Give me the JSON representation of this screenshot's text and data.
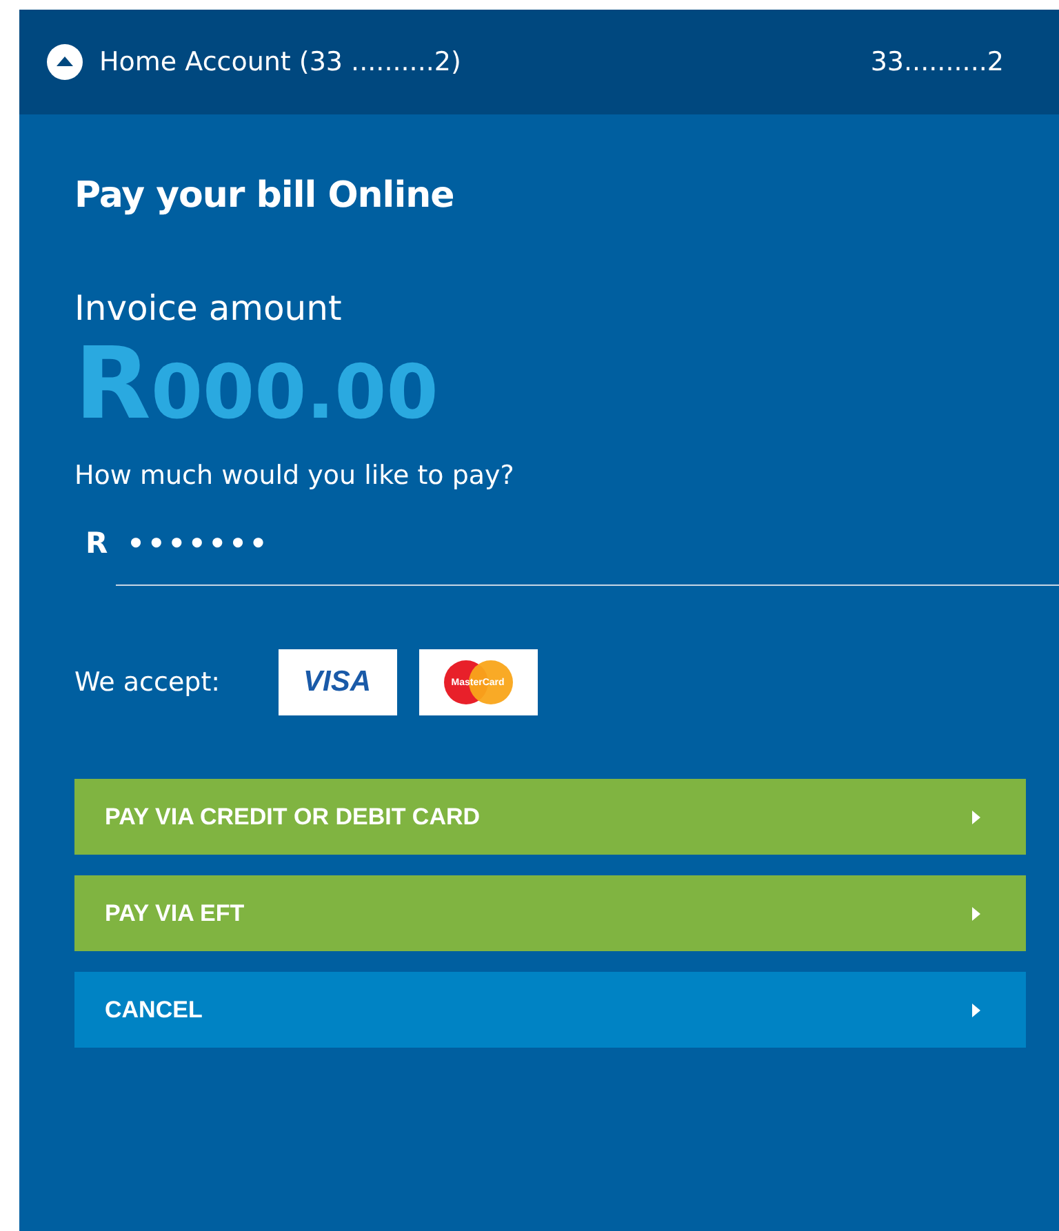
{
  "header": {
    "expanded": true,
    "title": "Home Account (33 ..........2)",
    "account_number": "33..........2"
  },
  "heading": "Pay your bill Online",
  "invoice": {
    "label": "Invoice amount",
    "currency": "R",
    "amount": "000.00"
  },
  "payment": {
    "question": "How much would you like to pay?",
    "prefix": "R",
    "value": "•••••••"
  },
  "accepted": {
    "label": "We accept:",
    "cards": [
      {
        "kind": "visa",
        "label": "VISA"
      },
      {
        "kind": "mastercard",
        "label": "MasterCard"
      }
    ]
  },
  "buttons": [
    {
      "label": "PAY VIA CREDIT OR DEBIT CARD",
      "kind": "primary"
    },
    {
      "label": "PAY VIA EFT",
      "kind": "primary"
    },
    {
      "label": "CANCEL",
      "kind": "secondary"
    }
  ]
}
